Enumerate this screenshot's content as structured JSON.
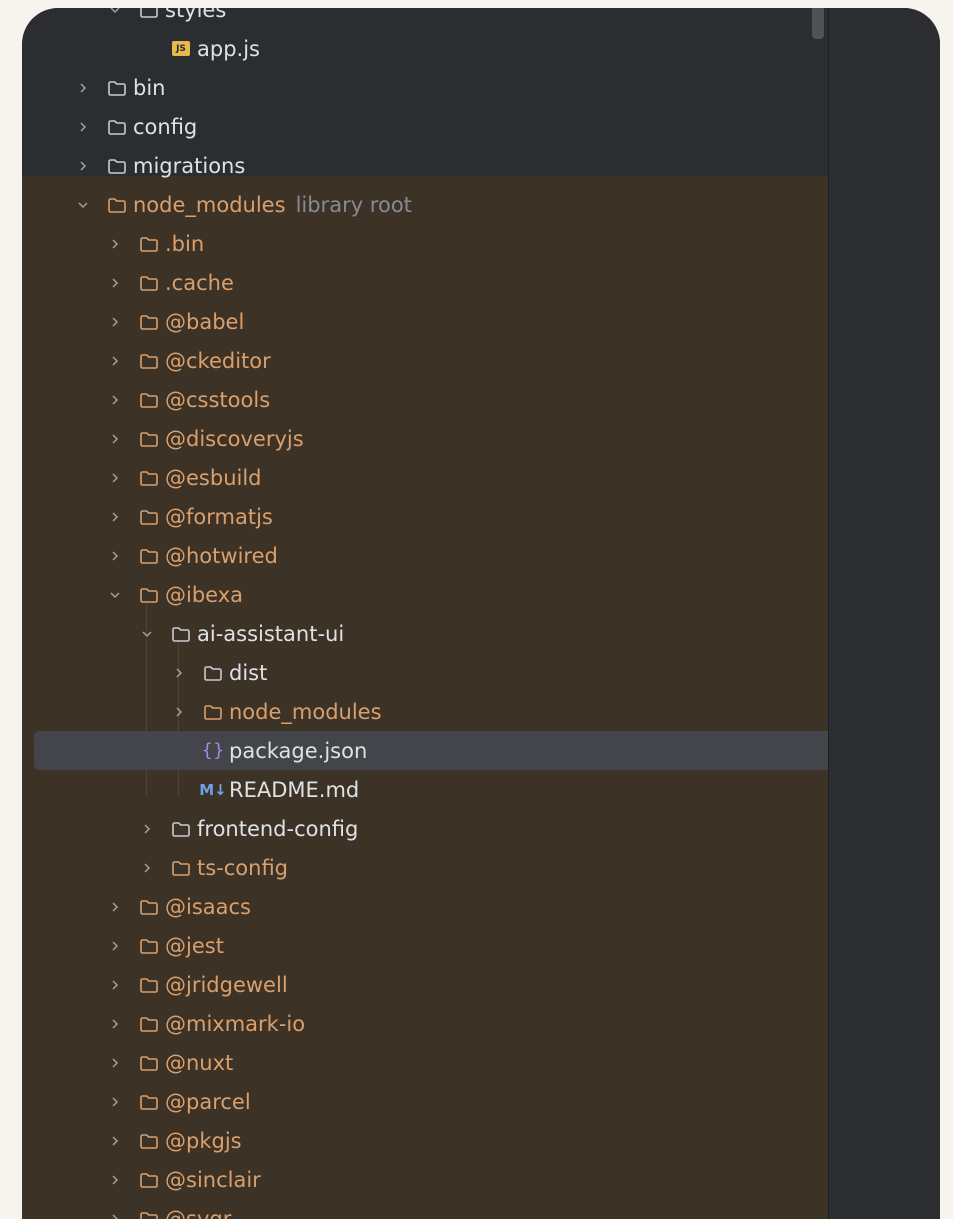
{
  "tree": {
    "colors": {
      "background": "#2b2d30",
      "library_background": "#3d3226",
      "selected": "#43454a",
      "excluded_text": "#d9a06d",
      "normal_text": "#dfe1e5"
    },
    "rows": [
      {
        "label": "styles",
        "depth": 1,
        "kind": "folder",
        "expanded": true,
        "excluded": false
      },
      {
        "label": "app.js",
        "depth": 2,
        "kind": "js-file",
        "excluded": false
      },
      {
        "label": "bin",
        "depth": 0,
        "kind": "folder",
        "expanded": false,
        "excluded": false
      },
      {
        "label": "config",
        "depth": 0,
        "kind": "folder",
        "expanded": false,
        "excluded": false
      },
      {
        "label": "migrations",
        "depth": 0,
        "kind": "folder",
        "expanded": false,
        "excluded": false
      },
      {
        "label": "node_modules",
        "hint": "library root",
        "depth": 0,
        "kind": "folder",
        "expanded": true,
        "excluded": true
      },
      {
        "label": ".bin",
        "depth": 1,
        "kind": "folder",
        "expanded": false,
        "excluded": true
      },
      {
        "label": ".cache",
        "depth": 1,
        "kind": "folder",
        "expanded": false,
        "excluded": true
      },
      {
        "label": "@babel",
        "depth": 1,
        "kind": "folder",
        "expanded": false,
        "excluded": true
      },
      {
        "label": "@ckeditor",
        "depth": 1,
        "kind": "folder",
        "expanded": false,
        "excluded": true
      },
      {
        "label": "@csstools",
        "depth": 1,
        "kind": "folder",
        "expanded": false,
        "excluded": true
      },
      {
        "label": "@discoveryjs",
        "depth": 1,
        "kind": "folder",
        "expanded": false,
        "excluded": true
      },
      {
        "label": "@esbuild",
        "depth": 1,
        "kind": "folder",
        "expanded": false,
        "excluded": true
      },
      {
        "label": "@formatjs",
        "depth": 1,
        "kind": "folder",
        "expanded": false,
        "excluded": true
      },
      {
        "label": "@hotwired",
        "depth": 1,
        "kind": "folder",
        "expanded": false,
        "excluded": true
      },
      {
        "label": "@ibexa",
        "depth": 1,
        "kind": "folder",
        "expanded": true,
        "excluded": true
      },
      {
        "label": "ai-assistant-ui",
        "depth": 2,
        "kind": "folder",
        "expanded": true,
        "excluded": false
      },
      {
        "label": "dist",
        "depth": 3,
        "kind": "folder",
        "expanded": false,
        "excluded": false
      },
      {
        "label": "node_modules",
        "depth": 3,
        "kind": "folder",
        "expanded": false,
        "excluded": true
      },
      {
        "label": "package.json",
        "depth": 3,
        "kind": "json-file",
        "excluded": false,
        "selected": true
      },
      {
        "label": "README.md",
        "depth": 3,
        "kind": "md-file",
        "excluded": false
      },
      {
        "label": "frontend-config",
        "depth": 2,
        "kind": "folder",
        "expanded": false,
        "excluded": false
      },
      {
        "label": "ts-config",
        "depth": 2,
        "kind": "folder",
        "expanded": false,
        "excluded": true
      },
      {
        "label": "@isaacs",
        "depth": 1,
        "kind": "folder",
        "expanded": false,
        "excluded": true
      },
      {
        "label": "@jest",
        "depth": 1,
        "kind": "folder",
        "expanded": false,
        "excluded": true
      },
      {
        "label": "@jridgewell",
        "depth": 1,
        "kind": "folder",
        "expanded": false,
        "excluded": true
      },
      {
        "label": "@mixmark-io",
        "depth": 1,
        "kind": "folder",
        "expanded": false,
        "excluded": true
      },
      {
        "label": "@nuxt",
        "depth": 1,
        "kind": "folder",
        "expanded": false,
        "excluded": true
      },
      {
        "label": "@parcel",
        "depth": 1,
        "kind": "folder",
        "expanded": false,
        "excluded": true
      },
      {
        "label": "@pkgjs",
        "depth": 1,
        "kind": "folder",
        "expanded": false,
        "excluded": true
      },
      {
        "label": "@sinclair",
        "depth": 1,
        "kind": "folder",
        "expanded": false,
        "excluded": true
      },
      {
        "label": "@svgr",
        "depth": 1,
        "kind": "folder",
        "expanded": false,
        "excluded": true
      }
    ]
  }
}
